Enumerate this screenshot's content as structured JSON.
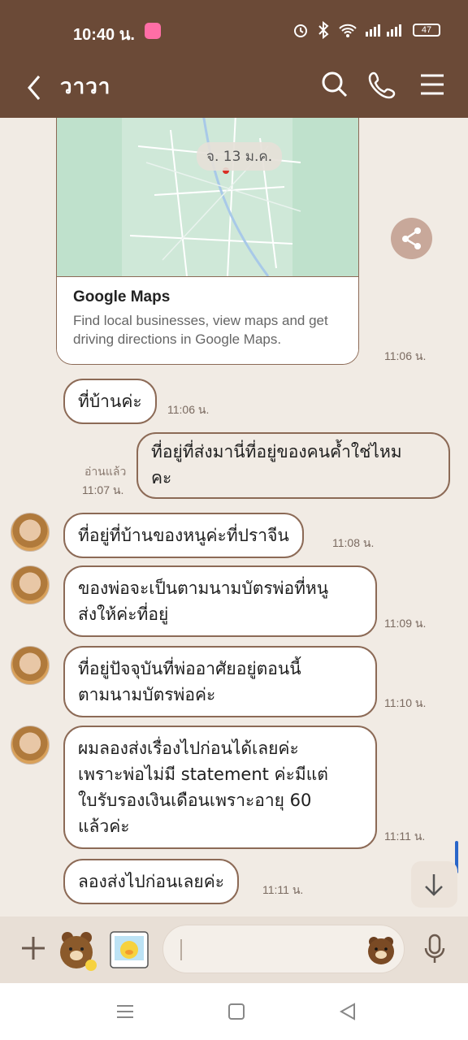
{
  "status_bar": {
    "time": "10:40 น.",
    "battery": "47"
  },
  "header": {
    "title": "วาวา"
  },
  "map_card": {
    "date_pill": "จ. 13 ม.ค.",
    "title": "Google Maps",
    "description": "Find local businesses, view maps and get driving directions in Google Maps.",
    "time": "11:06 น."
  },
  "messages": [
    {
      "side": "mine",
      "text": "ที่บ้านค่ะ",
      "time": "11:06 น."
    },
    {
      "side": "theirs",
      "text": "ที่อยู่ที่ส่งมานี่ที่อยู่ของคนค้ำใช่ไหมคะ",
      "read": "อ่านแล้ว",
      "time": "11:07 น."
    },
    {
      "side": "mine",
      "text": "ที่อยู่ที่บ้านของหนูค่ะที่ปราจีน",
      "time": "11:08 น."
    },
    {
      "side": "mine",
      "text": "ของพ่อจะเป็นตามนามบัตรพ่อที่หนูส่งให้ค่ะที่อยู่",
      "time": "11:09 น."
    },
    {
      "side": "mine",
      "text": "ที่อยู่ปัจจุบันที่พ่ออาศัยอยู่ตอนนี้ตามนามบัตรพ่อค่ะ",
      "time": "11:10 น."
    },
    {
      "side": "mine",
      "text": "ผมลองส่งเรื่องไปก่อนได้เลยค่ะเพราะพ่อไม่มี statement ค่ะมีแต่ใบรับรองเงินเดือนเพราะอายุ 60 แล้วค่ะ",
      "time": "11:11 น."
    },
    {
      "side": "mine",
      "text": "ลองส่งไปก่อนเลยค่ะ",
      "time": "11:11 น."
    }
  ],
  "display_lines": {
    "m1": "ที่บ้านค่ะ",
    "m2a": "ที่อยู่ที่ส่งมานี่ที่อยู่ของคนค้ำใช่ไหม",
    "m2b": "คะ",
    "m3": "ที่อยู่ที่บ้านของหนูค่ะที่ปราจีน",
    "m4a": "ของพ่อจะเป็นตามนามบัตรพ่อที่หนู",
    "m4b": "ส่งให้ค่ะที่อยู่",
    "m5a": "ที่อยู่ปัจจุบันที่พ่ออาศัยอยู่ตอนนี้",
    "m5b": "ตามนามบัตรพ่อค่ะ",
    "m6a": "ผมลองส่งเรื่องไปก่อนได้เลยค่ะ",
    "m6b": "เพราะพ่อไม่มี statement ค่ะมีแต่",
    "m6c": "ใบรับรองเงินเดือนเพราะอายุ 60",
    "m6d": "แล้วค่ะ",
    "m7": "ลองส่งไปก่อนเลยค่ะ"
  },
  "colors": {
    "header": "#6b4a37",
    "bubble_border": "#8c6a56",
    "chat_bg": "#f1ebe4"
  },
  "icons": [
    "back-icon",
    "search-icon",
    "phone-icon",
    "menu-icon",
    "share-icon",
    "arrow-down-icon",
    "plus-icon",
    "mic-icon",
    "emoji-icon"
  ]
}
